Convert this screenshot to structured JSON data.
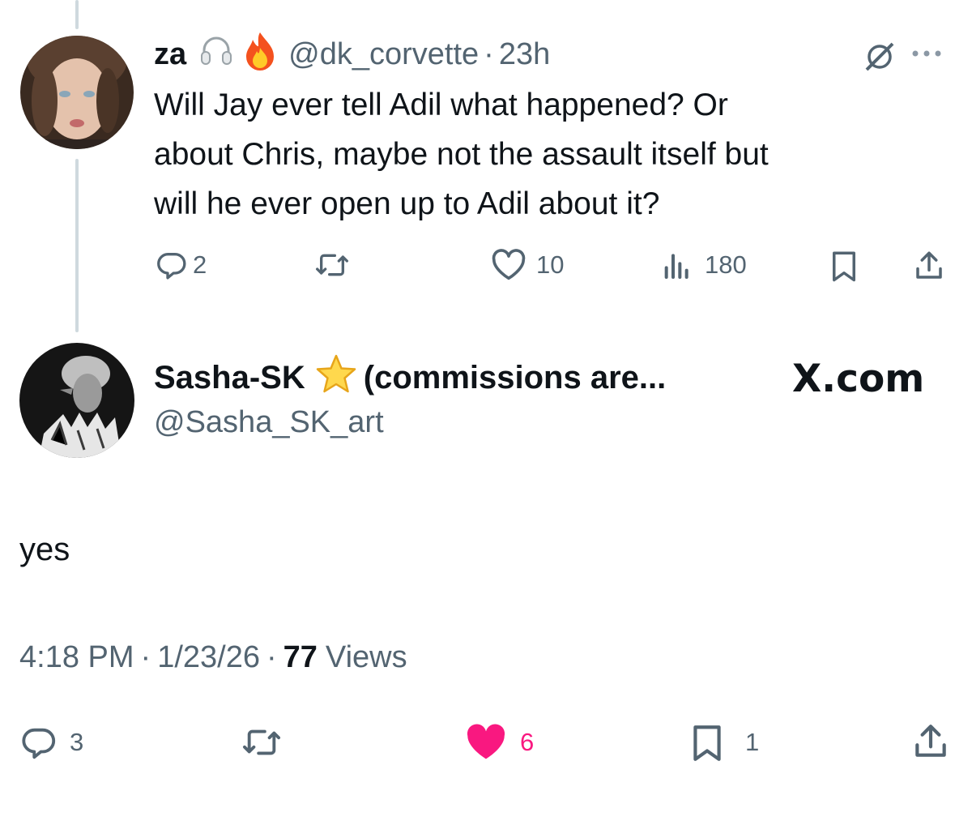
{
  "quoted_tweet": {
    "display_name": "za",
    "handle": "@dk_corvette",
    "separator": "·",
    "time": "23h",
    "text_lines": [
      "Will Jay ever tell Adil what happened? Or",
      "about Chris, maybe not the assault itself but",
      "will he ever open up to Adil about it?"
    ],
    "actions": {
      "replies": "2",
      "likes": "10",
      "views": "180"
    }
  },
  "reply_tweet": {
    "display_name": "Sasha-SK",
    "display_name_suffix": "(commissions are...",
    "handle": "@Sasha_SK_art",
    "brand": "X.com",
    "text": "yes",
    "meta": {
      "time": "4:18 PM",
      "dot1": "·",
      "date": "1/23/26",
      "dot2": "·",
      "views_count": "77",
      "views_label": "Views"
    },
    "actions": {
      "replies": "3",
      "likes": "6",
      "bookmarks": "1"
    }
  },
  "colors": {
    "text": "#0f1419",
    "secondary": "#536471",
    "like_active": "#f91880",
    "thread_line": "#cfd9de"
  },
  "icons": [
    "headphones-icon",
    "fire-icon",
    "grok-icon",
    "more-icon",
    "reply-icon",
    "retweet-icon",
    "like-icon",
    "views-icon",
    "bookmark-icon",
    "share-icon",
    "star-icon"
  ]
}
